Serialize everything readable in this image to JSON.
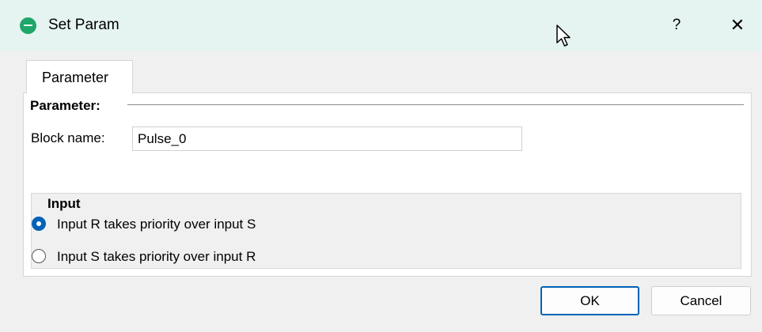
{
  "window": {
    "title": "Set Param",
    "help_label": "?",
    "close_label": "✕"
  },
  "tabs": [
    {
      "label": "Parameter",
      "selected": true
    }
  ],
  "parameter_section": {
    "title": "Parameter:",
    "block_name_label": "Block name:",
    "block_name_value": "Pulse_0"
  },
  "input_group": {
    "title": "Input",
    "options": [
      {
        "label": "Input R takes priority over input S",
        "selected": true
      },
      {
        "label": "Input S takes priority over input R",
        "selected": false
      }
    ]
  },
  "buttons": {
    "ok_label": "OK",
    "cancel_label": "Cancel"
  },
  "colors": {
    "titlebar_bg": "#e6f4f1",
    "accent": "#0062b8",
    "app_icon": "#1fa66a"
  }
}
